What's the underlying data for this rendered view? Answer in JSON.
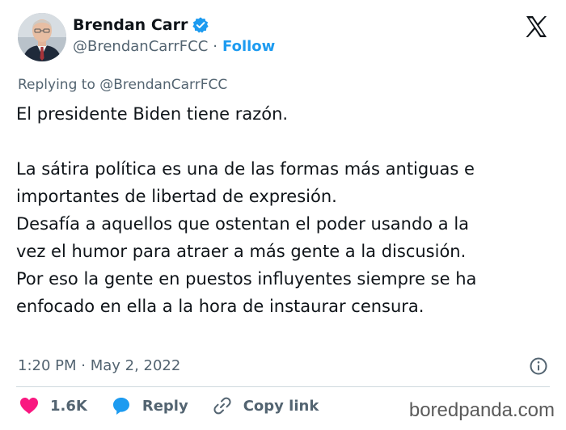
{
  "author": {
    "display_name": "Brendan Carr",
    "handle": "@BrendanCarrFCC",
    "separator": "·",
    "follow_label": "Follow",
    "verified": true
  },
  "tweet": {
    "replying_to": "Replying to @BrendanCarrFCC",
    "lines": [
      "El presidente Biden tiene razón.",
      "",
      "La sátira política es una de las formas más antiguas e",
      "importantes de libertad de expresión.",
      "Desafía a aquellos que ostentan el poder usando a la",
      "vez el humor para atraer a más gente a la discusión.",
      "Por eso la gente en puestos influyentes siempre se ha",
      "enfocado en ella a la hora de instaurar censura."
    ],
    "timestamp": "1:20 PM · May 2, 2022"
  },
  "actions": {
    "likes": "1.6K",
    "reply_label": "Reply",
    "copy_link_label": "Copy link"
  },
  "watermark": "boredpanda.com",
  "colors": {
    "accent": "#1d9bf0",
    "text": "#0f1419",
    "muted": "#536471",
    "like": "#f91880"
  },
  "icons": [
    "x-logo-icon",
    "verified-badge-icon",
    "info-icon",
    "heart-icon",
    "reply-bubble-icon",
    "link-icon"
  ]
}
